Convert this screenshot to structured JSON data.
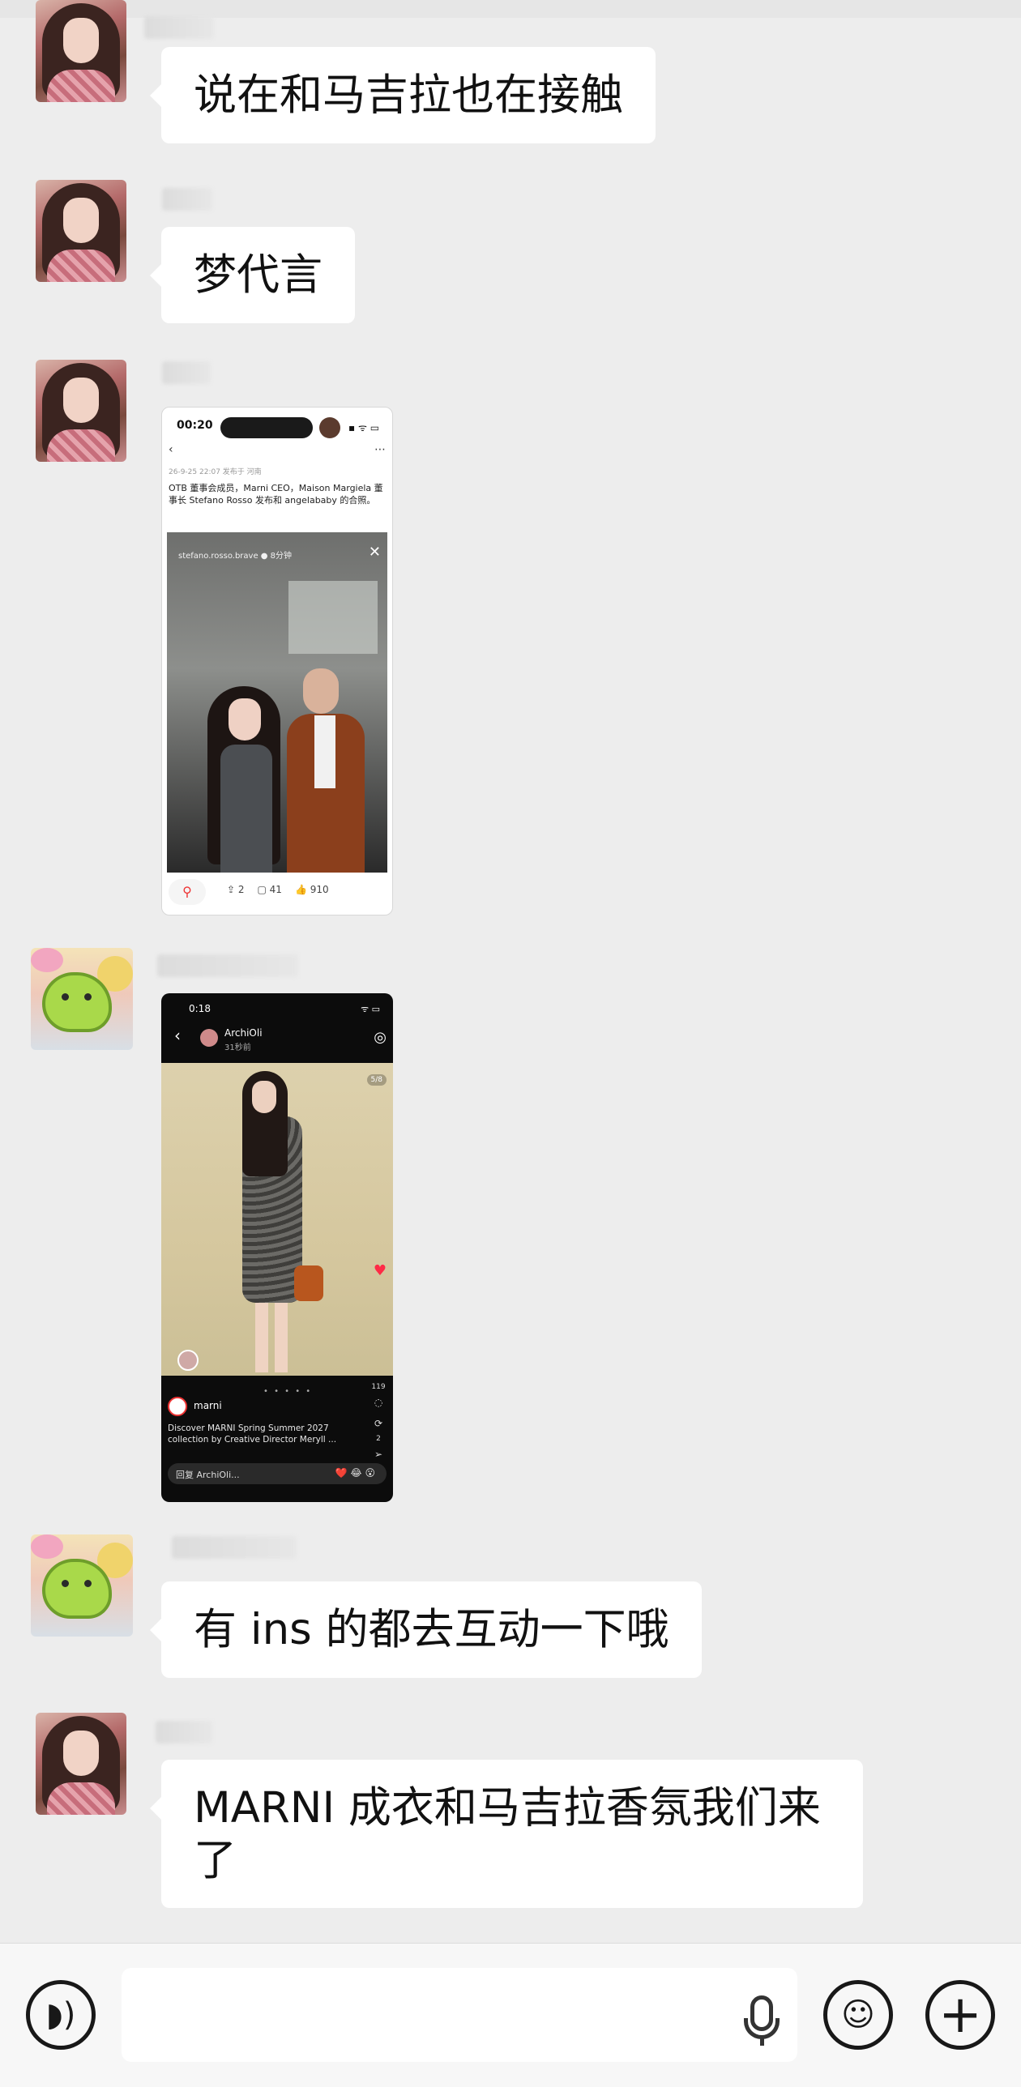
{
  "messages": [
    {
      "type": "text",
      "text": "说在和马吉拉也在接触"
    },
    {
      "type": "text",
      "text": "梦代言"
    },
    {
      "type": "image",
      "screenshot": {
        "time": "00:20",
        "post_meta": "26-9-25 22:07  发布于 河南",
        "caption": "OTB 董事会成员，Marni CEO，Maison Margiela 董事长 Stefano Rosso 发布和 angelababy 的合照。",
        "embedded_user": "stefano.rosso.brave ● 8分钟",
        "shares": "2",
        "comments": "41",
        "likes": "910"
      }
    },
    {
      "type": "image",
      "screenshot": {
        "time": "0:18",
        "user": "ArchiOli",
        "time_ago": "31秒前",
        "counter": "5/8",
        "brand": "marni",
        "description": "Discover MARNI Spring Summer 2027 collection by Creative Director Meryll ...",
        "reply_placeholder": "回复 ArchiOli...",
        "side_like": "119",
        "side_repost": "2"
      }
    },
    {
      "type": "text",
      "text": "有 ins 的都去互动一下哦"
    },
    {
      "type": "text",
      "text": "MARNI 成衣和马吉拉香氛我们来了"
    }
  ],
  "icons": {
    "voice": "voice-input-icon",
    "mic": "microphone-icon",
    "emoji": "emoji-icon",
    "plus": "plus-icon"
  },
  "colors": {
    "chat_bg": "#ededed",
    "bubble_bg": "#ffffff",
    "input_bar_bg": "#f7f7f7"
  }
}
